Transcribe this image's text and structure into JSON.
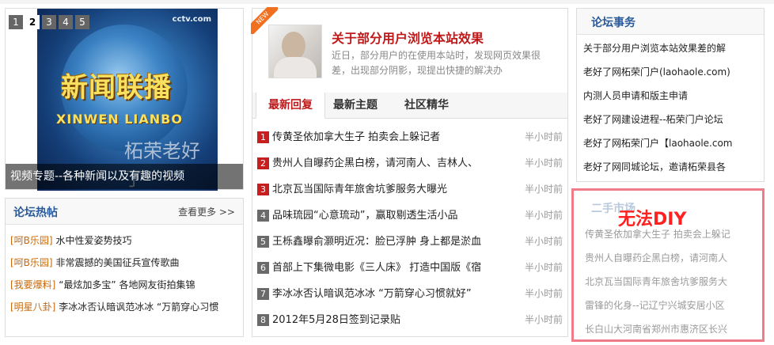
{
  "slideshow": {
    "pages": [
      "1",
      "2",
      "3",
      "4",
      "5"
    ],
    "active_page": "2",
    "caption": "视频专题--各种新闻以及有趣的视频",
    "image_text_cn": "新闻联播",
    "image_text_en": "XINWEN LIANBO",
    "image_watermark": "柘荣老好了",
    "channel_logo": "cctv.com"
  },
  "hot_posts": {
    "title": "论坛热帖",
    "more": "查看更多 >>",
    "items": [
      {
        "tag": "[呵B乐园]",
        "text": "水中性爱姿势技巧"
      },
      {
        "tag": "[呵B乐园]",
        "text": "非常震撼的美国征兵宣传歌曲"
      },
      {
        "tag": "[我要爆料]",
        "text": "“最炫加多宝” 各地网友街拍集锦"
      },
      {
        "tag": "[明星八卦]",
        "text": "李冰冰否认暗讽范冰冰 “万箭穿心习惯"
      }
    ]
  },
  "featured": {
    "badge": "NEW",
    "title": "关于部分用户浏览本站效果",
    "desc": "近日，部分用户的在使用本站时，发现网页效果很差，出现部分阴影，现提出快捷的解决办"
  },
  "tabs": [
    "最新回复",
    "最新主题",
    "社区精华"
  ],
  "latest": [
    {
      "n": "1",
      "title": "传黄圣依加拿大生子 拍卖会上躲记者",
      "time": "半小时前"
    },
    {
      "n": "2",
      "title": "贵州人自曝药企黑白榜，请河南人、吉林人、",
      "time": "半小时前"
    },
    {
      "n": "3",
      "title": "北京瓦当国际青年旅舍坑爹服务大曝光",
      "time": "半小时前"
    },
    {
      "n": "4",
      "title": "品味琉园“心意琉动”，赢取剔透生活小品",
      "time": "半小时前"
    },
    {
      "n": "5",
      "title": "王栎鑫曝俞灏明近况：脸已浮肿 身上都是淤血",
      "time": "半小时前"
    },
    {
      "n": "6",
      "title": "首部上下集微电影《三人床》 打造中国版《宿",
      "time": "半小时前"
    },
    {
      "n": "7",
      "title": "李冰冰否认暗讽范冰冰 “万箭穿心习惯就好”",
      "time": "半小时前"
    },
    {
      "n": "8",
      "title": "2012年5月28日签到记录贴",
      "time": "半小时前"
    }
  ],
  "affairs": {
    "title": "论坛事务",
    "items": [
      "关于部分用户浏览本站效果差的解",
      "老好了网柘荣门户(laohaole.com)",
      "内测人员申请和版主申请",
      "老好了网建设进程--柘荣门户论坛",
      "老好了网柘荣门户【laohaole.com",
      "老好了网同城论坛，邀请柘荣县各"
    ]
  },
  "market": {
    "title": "二手市场",
    "overlay": "无法DIY",
    "items": [
      "传黄圣依加拿大生子 拍卖会上躲记",
      "贵州人自曝药企黑白榜，请河南人",
      "北京瓦当国际青年旅舍坑爹服务大",
      "雷锋的化身--记辽宁兴城安居小区",
      "长白山大河南省郑州市惠济区长兴"
    ]
  },
  "colors": {
    "accent_red": "#c0191a",
    "title_blue": "#2a5a9a",
    "tag_orange": "#c8690b",
    "highlight_border": "#f07c8a"
  }
}
